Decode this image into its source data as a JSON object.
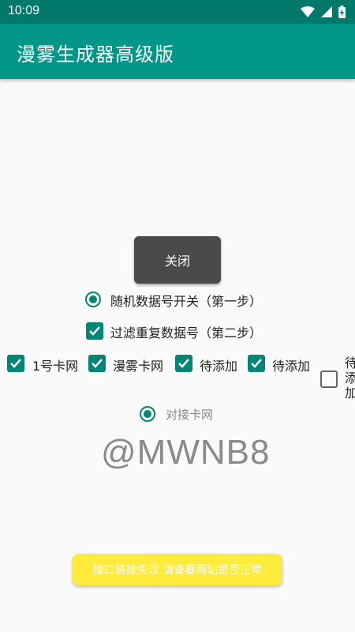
{
  "statusbar": {
    "time": "10:09"
  },
  "appbar": {
    "title": "漫雾生成器高级版"
  },
  "close_button": {
    "label": "关闭"
  },
  "options": {
    "random_switch": {
      "label": "随机数据号开关（第一步）",
      "checked": true
    },
    "filter_duplicates": {
      "label": "过滤重复数据号（第二步）",
      "checked": true
    },
    "source_1": {
      "label": "1号卡网",
      "checked": true
    },
    "source_2": {
      "label": "漫雾卡网",
      "checked": true
    },
    "source_3": {
      "label": "待添加",
      "checked": true
    },
    "source_4": {
      "label": "待添加",
      "checked": true
    },
    "source_5": {
      "label": "待添加",
      "checked": false
    },
    "dock_card_net": {
      "label": "对接卡网",
      "checked": true
    }
  },
  "watermark": "@MWNB8",
  "toast": "接口链接失败 请查看网站是否正常",
  "colors": {
    "primary": "#009688",
    "primary_dark": "#00796b",
    "accent": "#008577",
    "toast_bg": "#ffeb3b"
  }
}
